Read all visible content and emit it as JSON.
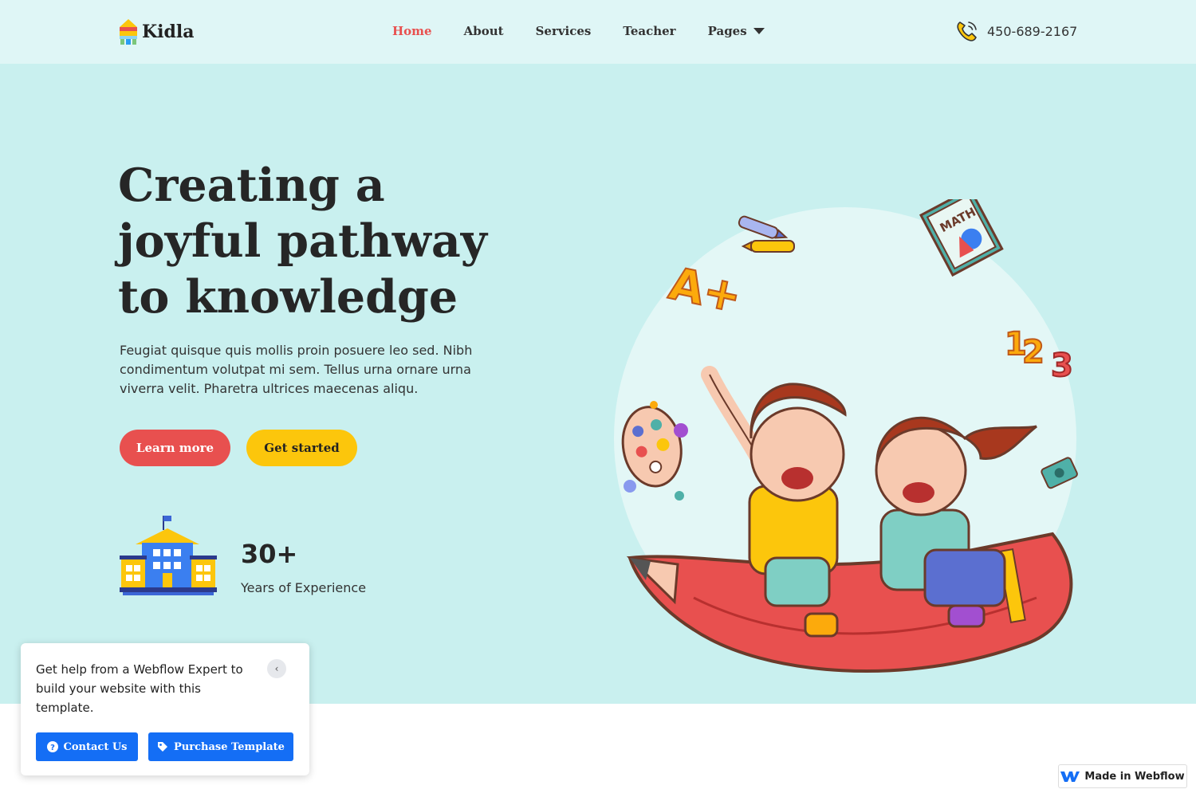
{
  "header": {
    "logo_text": "Kidla",
    "nav": [
      {
        "label": "Home",
        "active": true
      },
      {
        "label": "About"
      },
      {
        "label": "Services"
      },
      {
        "label": "Teacher"
      },
      {
        "label": "Pages"
      }
    ],
    "phone": "450-689-2167"
  },
  "hero": {
    "title": "Creating a joyful pathway to knowledge",
    "description": "Feugiat quisque quis mollis proin posuere leo sed. Nibh condimentum volutpat mi sem. Tellus urna ornare urna viverra velit. Pharetra ultrices maecenas aliqu.",
    "learn_more": "Learn more",
    "get_started": "Get started",
    "stat_number": "30+",
    "stat_label": "Years of Experience"
  },
  "helper": {
    "text": "Get help from a Webflow Expert to build your website with this template.",
    "contact_label": "Contact Us",
    "purchase_label": "Purchase Template"
  },
  "badge": {
    "label": "Made in Webflow"
  },
  "colors": {
    "accent_red": "#e8504f",
    "accent_yellow": "#fcc60c",
    "hero_bg": "#c9f0ef",
    "header_bg": "#dff6f6",
    "webflow_blue": "#146ef5"
  },
  "icons": [
    "logo-mark-icon",
    "chevron-down-icon",
    "phone-icon",
    "school-building-icon",
    "chevron-left-icon",
    "question-circle-icon",
    "tag-icon",
    "webflow-logo-icon"
  ]
}
